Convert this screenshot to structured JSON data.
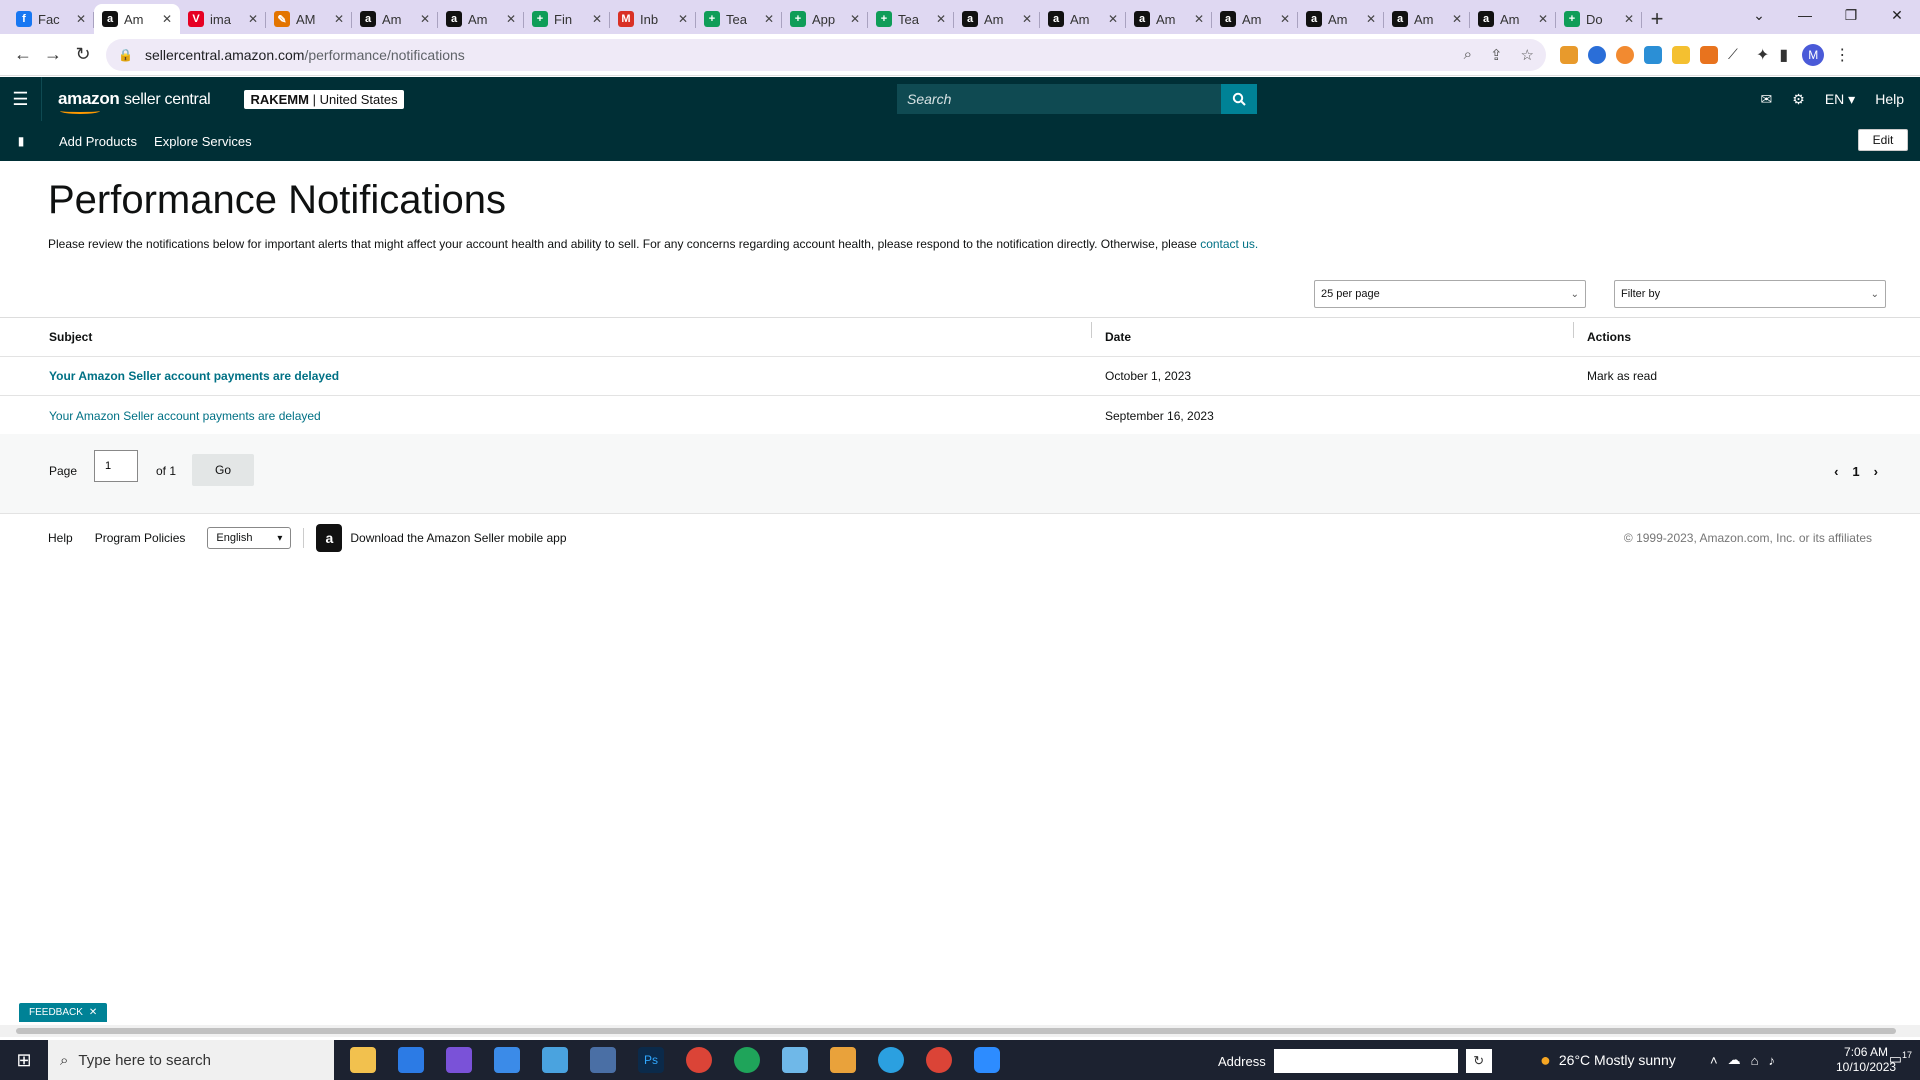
{
  "browser": {
    "tabs": [
      {
        "label": "Fac",
        "icon": "facebook-icon",
        "color": "#1877f2",
        "glyph": "f"
      },
      {
        "label": "Am",
        "icon": "amazon-icon",
        "color": "#111111",
        "glyph": "a",
        "active": true
      },
      {
        "label": "ima",
        "icon": "pinterest-icon",
        "color": "#e60023",
        "glyph": "V"
      },
      {
        "label": "AM",
        "icon": "edit-icon",
        "color": "#e37400",
        "glyph": "✎"
      },
      {
        "label": "Am",
        "icon": "amazon-icon",
        "color": "#111111",
        "glyph": "a"
      },
      {
        "label": "Am",
        "icon": "amazon-icon",
        "color": "#111111",
        "glyph": "a"
      },
      {
        "label": "Fin",
        "icon": "sheets-icon",
        "color": "#0f9d58",
        "glyph": "+"
      },
      {
        "label": "Inb",
        "icon": "gmail-icon",
        "color": "#d93025",
        "glyph": "M"
      },
      {
        "label": "Tea",
        "icon": "sheets-icon",
        "color": "#0f9d58",
        "glyph": "+"
      },
      {
        "label": "App",
        "icon": "sheets-icon",
        "color": "#0f9d58",
        "glyph": "+"
      },
      {
        "label": "Tea",
        "icon": "sheets-icon",
        "color": "#0f9d58",
        "glyph": "+"
      },
      {
        "label": "Am",
        "icon": "amazon-icon",
        "color": "#111111",
        "glyph": "a"
      },
      {
        "label": "Am",
        "icon": "amazon-icon",
        "color": "#111111",
        "glyph": "a"
      },
      {
        "label": "Am",
        "icon": "amazon-icon",
        "color": "#111111",
        "glyph": "a"
      },
      {
        "label": "Am",
        "icon": "amazon-icon",
        "color": "#111111",
        "glyph": "a"
      },
      {
        "label": "Am",
        "icon": "amazon-icon",
        "color": "#111111",
        "glyph": "a"
      },
      {
        "label": "Am",
        "icon": "amazon-icon",
        "color": "#111111",
        "glyph": "a"
      },
      {
        "label": "Am",
        "icon": "amazon-icon",
        "color": "#111111",
        "glyph": "a"
      },
      {
        "label": "Do",
        "icon": "sheets-icon",
        "color": "#0f9d58",
        "glyph": "+"
      }
    ],
    "url_host": "sellercentral.amazon.com",
    "url_path": "/performance/notifications",
    "profile_initial": "M"
  },
  "header": {
    "logo_brand": "amazon",
    "logo_product": "seller central",
    "merchant_name": "RAKEMM",
    "merchant_region": "| United States",
    "search_placeholder": "Search",
    "lang": "EN",
    "help": "Help"
  },
  "subnav": {
    "items": [
      "Add Products",
      "Explore Services"
    ],
    "edit_label": "Edit"
  },
  "main": {
    "title": "Performance Notifications",
    "intro_text": "Please review the notifications below for important alerts that might affect your account health and ability to sell. For any concerns regarding account health, please respond to the notification directly. Otherwise, please ",
    "intro_link": "contact us.",
    "per_page": "25 per page",
    "filter": "Filter by",
    "columns": {
      "subject": "Subject",
      "date": "Date",
      "actions": "Actions"
    },
    "rows": [
      {
        "subject": "Your Amazon Seller account payments are delayed",
        "date": "October 1, 2023",
        "action": "Mark as read",
        "unread": true
      },
      {
        "subject": "Your Amazon Seller account payments are delayed",
        "date": "September 16, 2023",
        "action": "",
        "unread": false
      }
    ],
    "pager": {
      "page_label": "Page",
      "page_value": "1",
      "of_label": "of 1",
      "go_label": "Go",
      "current": "1"
    }
  },
  "footer": {
    "help": "Help",
    "program_policies": "Program Policies",
    "language": "English",
    "app_text": "Download the Amazon Seller mobile app",
    "copyright": "© 1999-2023, Amazon.com, Inc. or its affiliates"
  },
  "feedback": {
    "label": "FEEDBACK"
  },
  "taskbar": {
    "search_placeholder": "Type here to search",
    "address_label": "Address",
    "weather": "26°C  Mostly sunny",
    "time": "7:06 AM",
    "date": "10/10/2023",
    "notif_count": "17"
  }
}
